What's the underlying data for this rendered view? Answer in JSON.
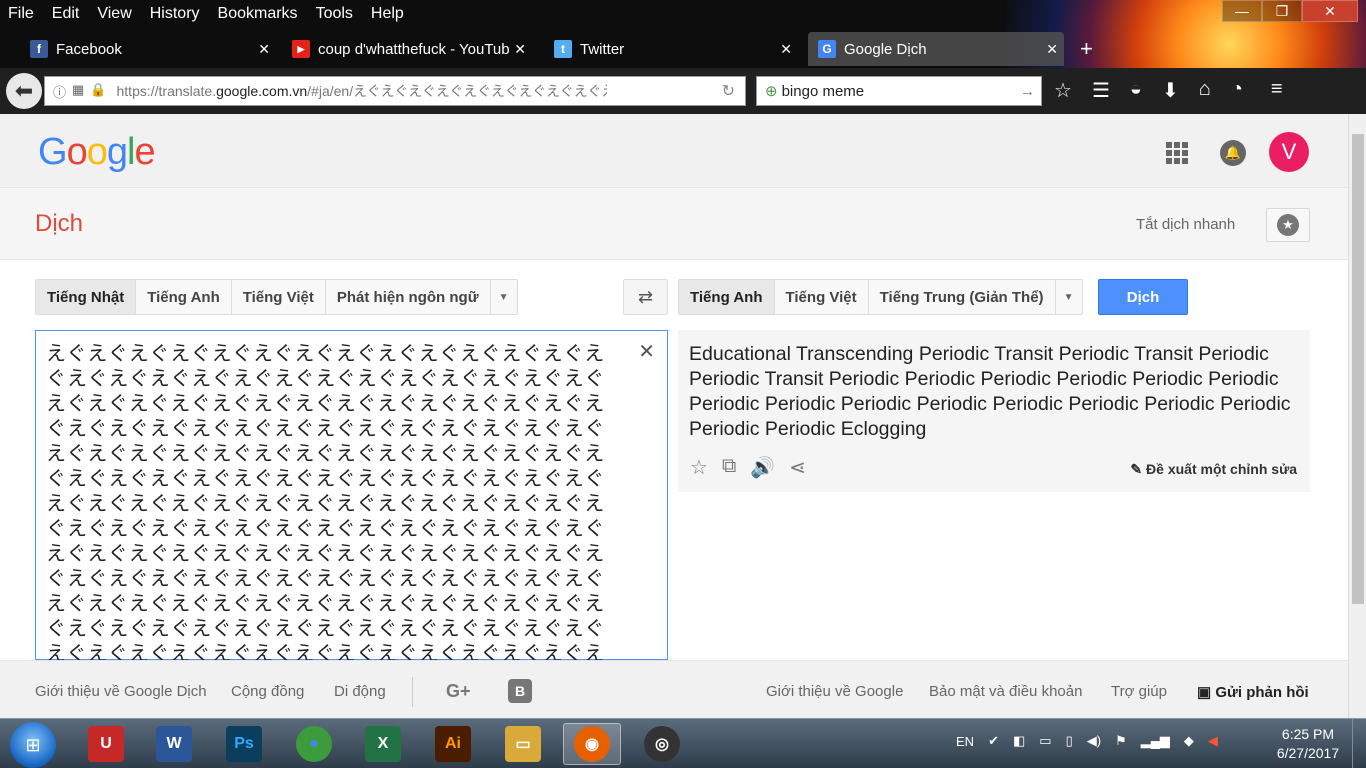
{
  "browser": {
    "menu": [
      "File",
      "Edit",
      "View",
      "History",
      "Bookmarks",
      "Tools",
      "Help"
    ],
    "window_controls": {
      "minimize": "—",
      "maximize": "❐",
      "close": "✕"
    },
    "tabs": [
      {
        "title": "Facebook",
        "icon": "facebook-icon",
        "icon_color": "#3b5998",
        "glyph": "f"
      },
      {
        "title": "coup d'whatthefuck - YouTub",
        "icon": "youtube-icon",
        "icon_color": "#e62117",
        "glyph": "▶"
      },
      {
        "title": "Twitter",
        "icon": "twitter-icon",
        "icon_color": "#55acee",
        "glyph": "t"
      },
      {
        "title": "Google Dịch",
        "icon": "google-translate-icon",
        "icon_color": "#4285f4",
        "glyph": "G"
      }
    ],
    "new_tab": "+",
    "url_prefix": "https://translate.",
    "url_domain": "google.com.vn",
    "url_rest": "/#ja/en/えぐえぐえぐえぐえぐえぐえぐえぐえぐえぐえぐえ",
    "search_value": "bingo meme"
  },
  "header": {
    "logo_letters": [
      "G",
      "o",
      "o",
      "g",
      "l",
      "e"
    ],
    "avatar_letter": "V"
  },
  "subbar": {
    "title": "Dịch",
    "instant_toggle": "Tắt dịch nhanh"
  },
  "source_langs": [
    "Tiếng Nhật",
    "Tiếng Anh",
    "Tiếng Việt",
    "Phát hiện ngôn ngữ"
  ],
  "target_langs": [
    "Tiếng Anh",
    "Tiếng Việt",
    "Tiếng Trung (Giản Thể)"
  ],
  "translate_button": "Dịch",
  "source_text": "えぐえぐえぐえぐえぐえぐえぐえぐえぐえぐえぐえぐえぐえぐえぐえぐえぐえぐえぐえぐえぐえぐえぐえぐえぐえぐえぐえぐえぐえぐえぐえぐえぐえぐえぐえぐえぐえぐえぐえぐえぐえぐえぐえぐえぐえぐえぐえぐえぐえぐえぐえぐえぐえぐえぐえぐえぐえぐえぐえぐえぐえぐえぐえぐえぐえぐえぐえぐえぐえぐえぐえぐえぐえぐえぐえぐえぐえぐえぐえぐえぐえぐえぐえぐえぐえぐえぐえぐえぐえぐえぐえぐえぐえぐえぐえぐえぐえぐえぐえぐえぐえぐえぐえぐえぐえぐえぐえぐえぐえぐえぐえぐえぐえぐえぐえぐえぐえぐえぐえぐえぐえぐえぐえぐえぐえぐえぐえぐえぐえぐえぐえぐえぐえぐえぐえぐえぐえぐえぐえぐえぐえぐえぐえぐえぐえぐえぐえぐえぐえぐえぐえぐえぐえぐえぐえぐえぐえぐえぐえぐえぐえぐえぐえぐえぐえぐえぐえぐえぐえぐえぐえぐえぐえぐえぐえぐえぐえぐえぐえぐえぐえぐえぐえぐえぐえぐえぐえぐえぐえぐえぐえぐえぐえぐえぐえぐえぐえぐえぐえぐえぐえぐ",
  "result_text": "Educational Transcending Periodic Transit Periodic Transit Periodic Periodic Transit Periodic Periodic Periodic Periodic Periodic Periodic Periodic Periodic Periodic Periodic Periodic Periodic Periodic Periodic Periodic Periodic Eclogging",
  "suggest_edit": "Đề xuất một chỉnh sửa",
  "footer": {
    "about_translate": "Giới thiệu về Google Dịch",
    "community": "Cộng đồng",
    "mobile": "Di động",
    "gplus": "G+",
    "blogger": "B",
    "about_google": "Giới thiệu về Google",
    "privacy": "Bảo mật và điều khoản",
    "help": "Trợ giúp",
    "feedback": "Gửi phản hồi"
  },
  "taskbar": {
    "apps": [
      {
        "name": "unikey",
        "label": "U",
        "color": "#c62828"
      },
      {
        "name": "word",
        "label": "W",
        "color": "#2b579a"
      },
      {
        "name": "photoshop",
        "label": "Ps",
        "color": "#0b3d5c"
      },
      {
        "name": "chrome",
        "label": "●",
        "color": "#3c9c3c"
      },
      {
        "name": "excel",
        "label": "X",
        "color": "#217346"
      },
      {
        "name": "illustrator",
        "label": "Ai",
        "color": "#e37b00"
      },
      {
        "name": "explorer",
        "label": "▭",
        "color": "#d9a93a"
      },
      {
        "name": "firefox",
        "label": "◉",
        "color": "#e66000"
      },
      {
        "name": "media-player",
        "label": "◎",
        "color": "#333333"
      }
    ],
    "lang": "EN",
    "time": "6:25 PM",
    "date": "6/27/2017"
  }
}
